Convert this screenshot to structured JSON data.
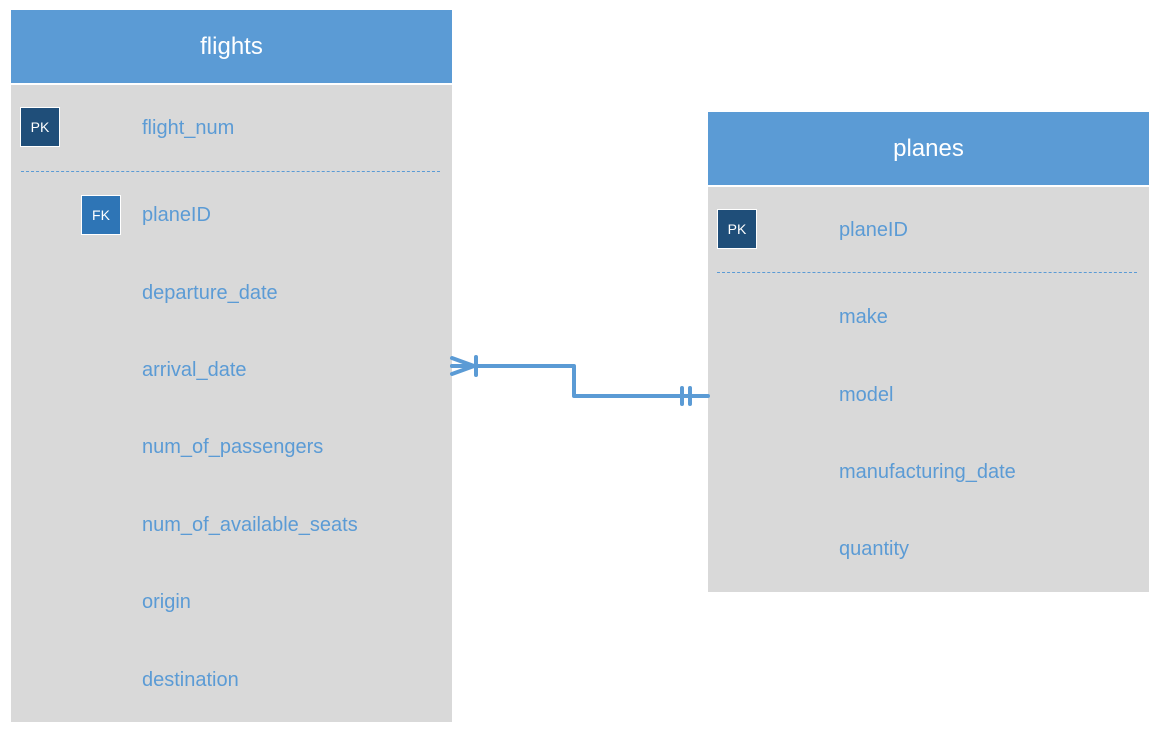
{
  "diagram": {
    "type": "entity-relationship",
    "colors": {
      "header": "#5b9bd5",
      "body": "#d9d9d9",
      "attribute_text": "#5b9bd5",
      "pk_badge": "#1f4e79",
      "fk_badge": "#2e75b6",
      "connector": "#5b9bd5"
    },
    "entities": {
      "flights": {
        "title": "flights",
        "primary_key": {
          "badge": "PK",
          "name": "flight_num"
        },
        "attributes": [
          {
            "badge": "FK",
            "name": "planeID"
          },
          {
            "badge": "",
            "name": "departure_date"
          },
          {
            "badge": "",
            "name": "arrival_date"
          },
          {
            "badge": "",
            "name": "num_of_passengers"
          },
          {
            "badge": "",
            "name": "num_of_available_seats"
          },
          {
            "badge": "",
            "name": "origin"
          },
          {
            "badge": "",
            "name": "destination"
          }
        ]
      },
      "planes": {
        "title": "planes",
        "primary_key": {
          "badge": "PK",
          "name": "planeID"
        },
        "attributes": [
          {
            "badge": "",
            "name": "make"
          },
          {
            "badge": "",
            "name": "model"
          },
          {
            "badge": "",
            "name": "manufacturing_date"
          },
          {
            "badge": "",
            "name": "quantity"
          }
        ]
      }
    },
    "relationships": [
      {
        "from": "flights",
        "to": "planes",
        "from_cardinality": "one-or-many",
        "to_cardinality": "exactly-one",
        "via": "planeID"
      }
    ]
  }
}
